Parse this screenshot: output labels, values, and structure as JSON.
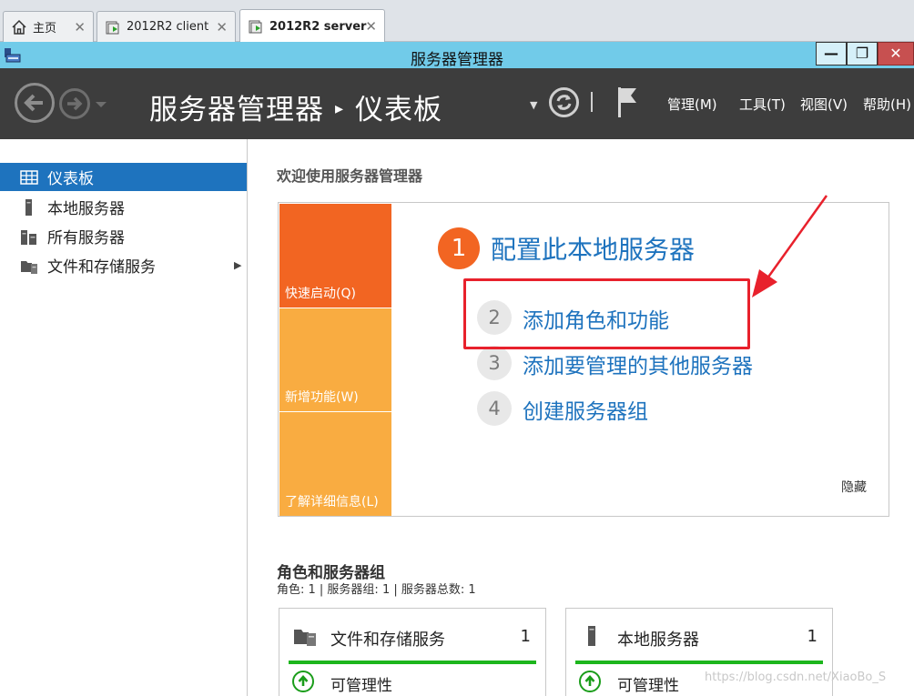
{
  "vm_tabs": [
    {
      "label": "主页",
      "icon": "home-icon",
      "active": false
    },
    {
      "label": "2012R2 client",
      "icon": "vm-icon",
      "active": false
    },
    {
      "label": "2012R2 server",
      "icon": "vm-icon",
      "active": true
    }
  ],
  "window": {
    "title": "服务器管理器",
    "controls": {
      "minimize": "—",
      "maximize": "❐",
      "close": "✕"
    }
  },
  "header": {
    "breadcrumb_app": "服务器管理器",
    "breadcrumb_page": "仪表板",
    "menus": [
      "管理(M)",
      "工具(T)",
      "视图(V)",
      "帮助(H)"
    ]
  },
  "sidebar": {
    "items": [
      {
        "label": "仪表板",
        "icon": "dashboard-icon",
        "selected": true
      },
      {
        "label": "本地服务器",
        "icon": "server-icon",
        "selected": false
      },
      {
        "label": "所有服务器",
        "icon": "servers-icon",
        "selected": false
      },
      {
        "label": "文件和存储服务",
        "icon": "file-storage-icon",
        "selected": false,
        "expandable": true
      }
    ]
  },
  "main": {
    "welcome": "欢迎使用服务器管理器",
    "quick_start": {
      "tiles": [
        "快速启动(Q)",
        "新增功能(W)",
        "了解详细信息(L)"
      ],
      "steps": [
        {
          "num": "1",
          "label": "配置此本地服务器"
        },
        {
          "num": "2",
          "label": "添加角色和功能"
        },
        {
          "num": "3",
          "label": "添加要管理的其他服务器"
        },
        {
          "num": "4",
          "label": "创建服务器组"
        }
      ],
      "hide": "隐藏"
    },
    "roles": {
      "title": "角色和服务器组",
      "summary": "角色: 1 | 服务器组: 1 | 服务器总数: 1",
      "cards": [
        {
          "title": "文件和存储服务",
          "count": "1",
          "status": "可管理性",
          "icon": "file-storage-icon"
        },
        {
          "title": "本地服务器",
          "count": "1",
          "status": "可管理性",
          "icon": "server-icon"
        }
      ]
    }
  },
  "watermark": "https://blog.csdn.net/XiaoBo_S",
  "colors": {
    "accent_blue": "#1e73be",
    "orange": "#f26522",
    "light_orange": "#f9ac41",
    "title_bar": "#71cbe9",
    "header_dark": "#3d3d3d",
    "status_green": "#1db61d",
    "annotation_red": "#e8212c"
  }
}
